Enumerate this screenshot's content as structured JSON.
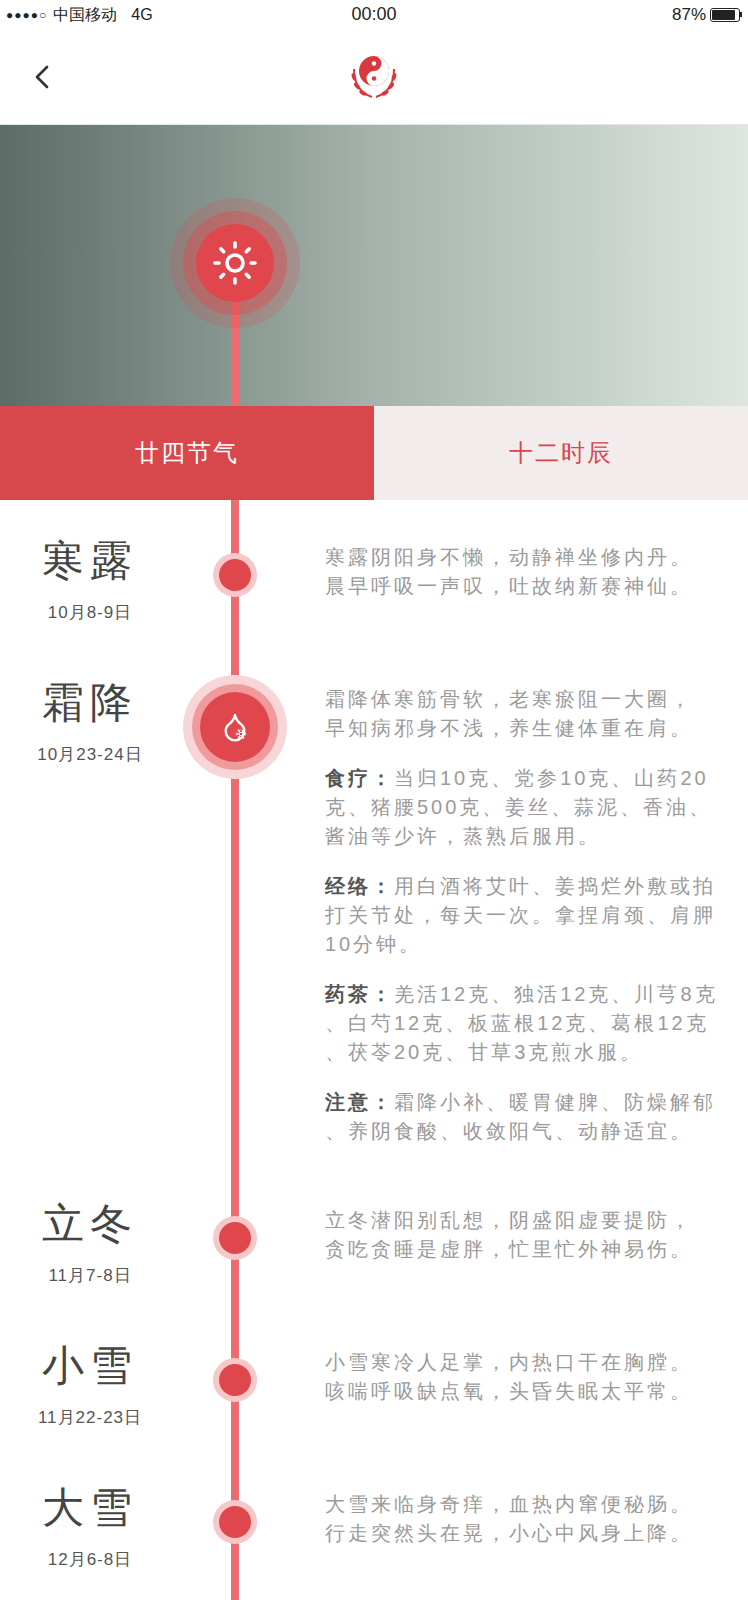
{
  "status_bar": {
    "signal": "●●●●○",
    "carrier": "中国移动",
    "network": "4G",
    "time": "00:00",
    "battery": "87%",
    "battery_level": 0.87
  },
  "tabs": [
    {
      "label": "廿四节气",
      "selected": true
    },
    {
      "label": "十二时辰",
      "selected": false
    }
  ],
  "terms": [
    {
      "name": "寒露",
      "date": "10月8-9日",
      "expanded": false,
      "verse": [
        "寒露阴阳身不懒，动静禅坐修内丹。",
        "晨早呼吸一声叹，吐故纳新赛神仙。"
      ],
      "details": []
    },
    {
      "name": "霜降",
      "date": "10月23-24日",
      "expanded": true,
      "verse": [
        "霜降体寒筋骨软，老寒瘀阻一大圈，",
        "早知病邪身不浅，养生健体重在肩。"
      ],
      "details": [
        {
          "label": "食疗：",
          "lines": [
            "当归10克、党参10克、山药20",
            "克、猪腰500克、姜丝、蒜泥、香油、",
            "酱油等少许，蒸熟后服用。"
          ]
        },
        {
          "label": "经络：",
          "lines": [
            "用白酒将艾叶、姜捣烂外敷或拍",
            "打关节处，每天一次。拿捏肩颈、肩胛",
            "10分钟。"
          ]
        },
        {
          "label": "药茶：",
          "lines": [
            "羌活12克、独活12克、川芎8克",
            "、白芍12克、板蓝根12克、葛根12克",
            "、茯苓20克、甘草3克煎水服。"
          ]
        },
        {
          "label": "注意：",
          "lines": [
            "霜降小补、暖胃健脾、防燥解郁",
            "、养阴食酸、收敛阳气、动静适宜。"
          ]
        }
      ]
    },
    {
      "name": "立冬",
      "date": "11月7-8日",
      "expanded": false,
      "verse": [
        "立冬潜阳别乱想，阴盛阳虚要提防，",
        "贪吃贪睡是虚胖，忙里忙外神易伤。"
      ],
      "details": []
    },
    {
      "name": "小雪",
      "date": "11月22-23日",
      "expanded": false,
      "verse": [
        "小雪寒冷人足掌，内热口干在胸膛。",
        "咳喘呼吸缺点氧，头昏失眠太平常。"
      ],
      "details": []
    },
    {
      "name": "大雪",
      "date": "12月6-8日",
      "expanded": false,
      "verse": [
        "大雪来临身奇痒，血热内窜便秘肠。",
        "行走突然头在晃，小心中风身上降。"
      ],
      "details": []
    }
  ]
}
